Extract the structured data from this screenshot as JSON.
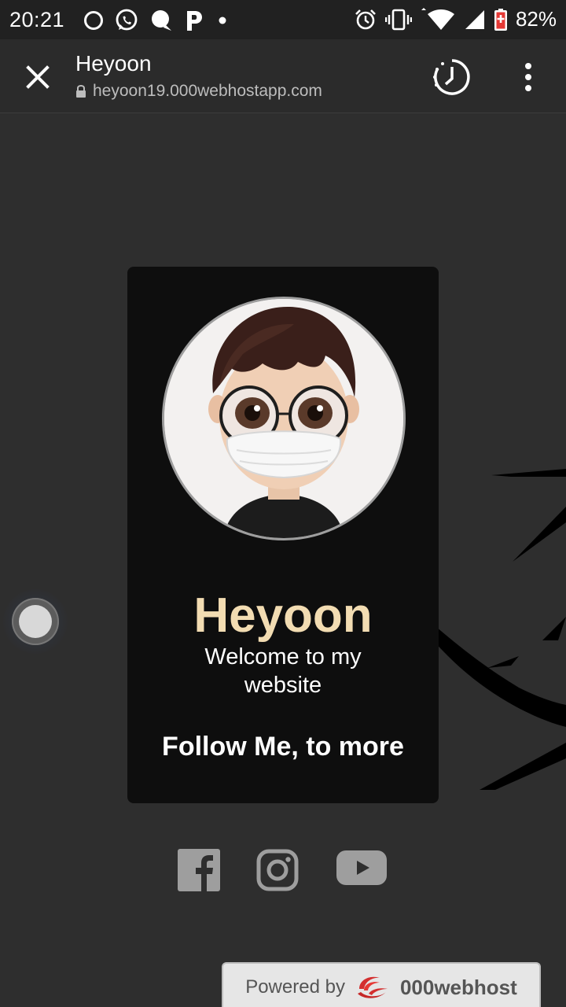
{
  "status_bar": {
    "time": "20:21",
    "battery_percent": "82%",
    "left_icons": [
      "circle-icon",
      "whatsapp-icon",
      "chat-bubble-icon",
      "p-app-icon",
      "dot-icon"
    ],
    "right_icons": [
      "alarm-icon",
      "vibrate-icon",
      "wifi-icon",
      "signal-icon",
      "battery-icon"
    ]
  },
  "toolbar": {
    "title": "Heyoon",
    "url": "heyoon19.000webhostapp.com"
  },
  "card": {
    "name": "Heyoon",
    "welcome": "Welcome to my website",
    "follow": "Follow Me, to more"
  },
  "socials": [
    "facebook-icon",
    "instagram-icon",
    "youtube-icon"
  ],
  "footer": {
    "powered_label": "Powered by",
    "brand": "000webhost"
  },
  "colors": {
    "page_bg": "#2e2e2e",
    "card_bg": "#0e0e0e",
    "name_color": "#f2dcb2",
    "icon_gray": "#9e9e9e"
  }
}
